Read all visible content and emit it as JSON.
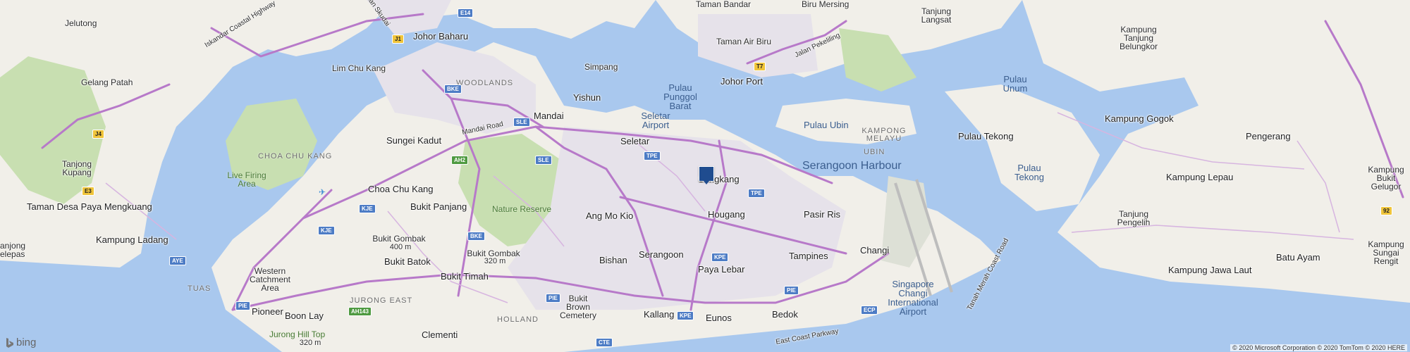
{
  "map": {
    "colors": {
      "water": "#a9c8ee",
      "land": "#f1efe9",
      "park": "#c8dfb1",
      "urban": "#e6e2ea",
      "highway": "#b779c9",
      "road": "#d7b5e0",
      "marker": "#1f4c8f"
    },
    "marker_name": "location-pin",
    "labels": {
      "jelutong": "Jelutong",
      "iskandar": "Iskandar Coastal Highway",
      "jalan_skudai": "Jalan Skudai",
      "johor_baharu": "Johor Baharu",
      "taman_bandar": "Taman Bandar",
      "biru_mersing": "Biru Mersing",
      "tanjung_langsat": "Tanjung Langsat",
      "taman_air_biru": "Taman Air Biru",
      "jalan_pekeliling": "Jalan Pekeliling",
      "johor_port": "Johor Port",
      "kampung_tanjung_belungkor": "Kampung Tanjung Belungkor",
      "lim_chu_kang": "Lim Chu Kang",
      "gelang_patah": "Gelang Patah",
      "simpang": "Simpang",
      "woodlands": "WOODLANDS",
      "yishun": "Yishun",
      "pulau_punggol_barat": "Pulau Punggol Barat",
      "pulau_unum": "Pulau Unum",
      "kampung_gogok": "Kampung Gogok",
      "mandai": "Mandai",
      "mandai_road": "Mandai Road",
      "seletar_airport": "Seletar Airport",
      "pulau_ubin": "Pulau Ubin",
      "kampong_melayu": "KAMPONG MELAYU",
      "pulau_tekong": "Pulau Tekong",
      "pengerang": "Pengerang",
      "sungei_kadut": "Sungei Kadut",
      "seletar": "Seletar",
      "ubin": "UBIN",
      "tanjong_kupang": "Tanjong Kupang",
      "choa_chu_kang_area": "CHOA CHU KANG",
      "serangoon_harbour": "Serangoon Harbour",
      "kampung_bukit_gelugor": "Kampung Bukit Gelugor",
      "live_firing_area": "Live Firing Area",
      "sengkang": "Sengkang",
      "pulau_tekong_small": "Pulau Tekong",
      "kampung_lepau": "Kampung Lepau",
      "choa_chu_kang": "Choa Chu Kang",
      "taman_desa": "Taman Desa Paya Mengkuang",
      "bukit_panjang": "Bukit Panjang",
      "nature_reserve": "Nature Reserve",
      "ang_mo_kio": "Ang Mo Kio",
      "hougang": "Hougang",
      "pasir_ris": "Pasir Ris",
      "tanjung_pengelih": "Tanjung Pengelih",
      "kampung_ladang": "Kampung Ladang",
      "bukit_gombak": "Bukit Gombak",
      "bukit_gombak_elev": "400 m",
      "changi": "Changi",
      "anjong_pelepas": "anjong\nelepas",
      "bukit_batok": "Bukit Batok",
      "bukit_batok_elev": "320 m",
      "bishan": "Bishan",
      "serangoon": "Serangoon",
      "paya_lebar": "Paya Lebar",
      "tampines": "Tampines",
      "western_catchment": "Western Catchment Area",
      "bukit_timah": "Bukit Timah",
      "singapore_changi": "Singapore Changi International Airport",
      "tanah_merah": "Tanah Merah Coast Road",
      "kampung_jawa_laut": "Kampung Jawa Laut",
      "batu_ayam": "Batu Ayam",
      "kampung_sungai_rengit": "Kampung Sungai Rengit",
      "tuas": "TUAS",
      "jurong_east": "JURONG EAST",
      "bukit_brown": "Bukit Brown Cemetery",
      "holland": "HOLLAND",
      "pioneer": "Pioneer",
      "boon_lay": "Boon Lay",
      "kallang": "Kallang",
      "eunos": "Eunos",
      "bedok": "Bedok",
      "jurong_hill": "Jurong Hill Top",
      "jurong_hill_elev": "320 m",
      "clementi": "Clementi",
      "east_coast_parkway": "East Coast Parkway"
    },
    "shields": {
      "e14": "E14",
      "j1": "J1",
      "t7": "T7",
      "bke": "BKE",
      "sle": "SLE",
      "j4": "J4",
      "ah2": "AH2",
      "tpe": "TPE",
      "tpe2": "TPE",
      "sle2": "SLE",
      "e3": "E3",
      "kje": "KJE",
      "bke2": "BKE",
      "kje2": "KJE",
      "ayé": "AYE",
      "kpe": "KPE",
      "pie": "PIE",
      "pie2": "PIE",
      "ecp": "ECP",
      "ah143": "AH143",
      "pie3": "PIE",
      "kpe2": "KPE",
      "cte": "CTE",
      "n92": "92"
    },
    "brand": "bing",
    "copyright": "© 2020 Microsoft Corporation © 2020 TomTom © 2020 HERE"
  }
}
